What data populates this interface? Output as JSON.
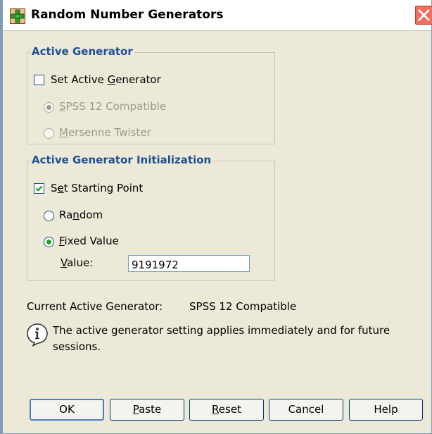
{
  "window": {
    "title": "Random Number Generators",
    "icon": "random-generator-app-icon",
    "close_icon": "close-icon"
  },
  "active_generator": {
    "legend": "Active Generator",
    "set_active": {
      "label_pre": "Set Active ",
      "label_ul": "G",
      "label_post": "enerator",
      "checked": false
    },
    "options": [
      {
        "label_pre": "",
        "label_ul": "S",
        "label_post": "PSS 12 Compatible",
        "selected": true,
        "enabled": false
      },
      {
        "label_pre": "",
        "label_ul": "M",
        "label_post": "ersenne Twister",
        "selected": false,
        "enabled": false
      }
    ]
  },
  "initialization": {
    "legend": "Active Generator Initialization",
    "set_starting": {
      "label_pre": "S",
      "label_ul": "e",
      "label_post": "t Starting Point",
      "checked": true
    },
    "options": [
      {
        "label_pre": "Ra",
        "label_ul": "n",
        "label_post": "dom",
        "selected": false
      },
      {
        "label_pre": "",
        "label_ul": "F",
        "label_post": "ixed Value",
        "selected": true
      }
    ],
    "value_label_ul": "V",
    "value_label_post": "alue:",
    "value": "9191972"
  },
  "current": {
    "label": "Current  Active Generator:",
    "value": "SPSS 12 Compatible"
  },
  "info": {
    "icon": "info-icon",
    "line1": "The active generator setting applies immediately and for future",
    "line2": "sessions."
  },
  "buttons": {
    "ok": {
      "pre": "",
      "ul": "",
      "post": "OK"
    },
    "paste": {
      "pre": "",
      "ul": "P",
      "post": "aste"
    },
    "reset": {
      "pre": "",
      "ul": "R",
      "post": "eset"
    },
    "cancel": {
      "pre": "",
      "ul": "",
      "post": "Cancel"
    },
    "help": {
      "pre": "",
      "ul": "",
      "post": "Help"
    }
  },
  "colors": {
    "legend": "#1f4f94",
    "dialog_bg": "#ece9d8",
    "close_button": "#f07060",
    "radio_dot": "#21a121",
    "disabled_text": "#9c9a8e"
  }
}
